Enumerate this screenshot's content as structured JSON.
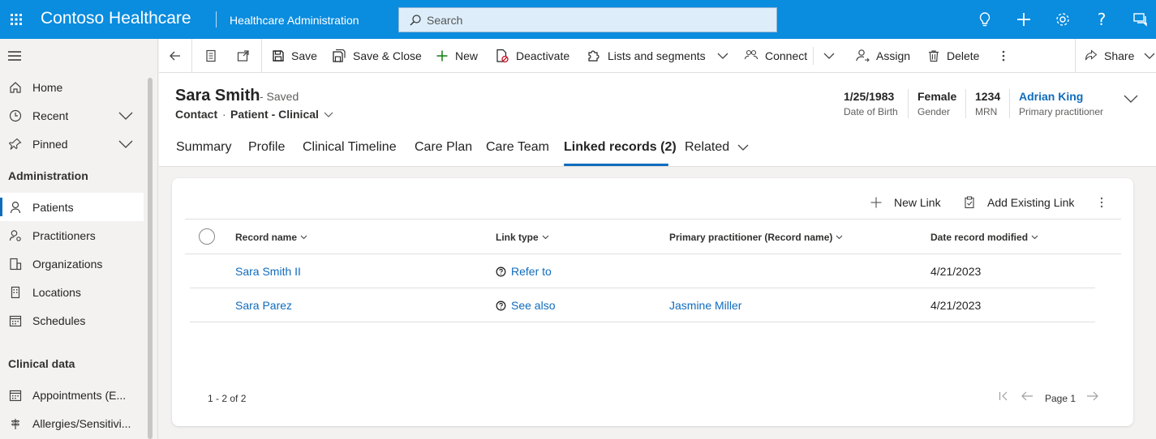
{
  "topbar": {
    "app_title": "Contoso Healthcare",
    "area_title": "Healthcare Administration",
    "search_placeholder": "Search",
    "icons": [
      "app-launcher-icon",
      "lightbulb-icon",
      "plus-icon",
      "settings-icon",
      "help-icon",
      "chat-icon"
    ]
  },
  "sidebar": {
    "items": [
      {
        "label": "Home",
        "icon": "home-icon"
      },
      {
        "label": "Recent",
        "icon": "clock-icon"
      },
      {
        "label": "Pinned",
        "icon": "pin-icon"
      }
    ],
    "group_admin": "Administration",
    "admin_items": [
      {
        "label": "Patients",
        "icon": "person-icon",
        "selected": true
      },
      {
        "label": "Practitioners",
        "icon": "practitioner-icon"
      },
      {
        "label": "Organizations",
        "icon": "organization-icon"
      },
      {
        "label": "Locations",
        "icon": "building-icon"
      },
      {
        "label": "Schedules",
        "icon": "calendar-icon"
      }
    ],
    "group_clinical": "Clinical data",
    "clinical_items": [
      {
        "label": "Appointments (E...",
        "icon": "calendar-icon"
      },
      {
        "label": "Allergies/Sensitivi...",
        "icon": "allergy-icon"
      }
    ]
  },
  "commands": {
    "save": "Save",
    "save_close": "Save & Close",
    "new": "New",
    "deactivate": "Deactivate",
    "lists": "Lists and segments",
    "connect": "Connect",
    "assign": "Assign",
    "delete": "Delete",
    "share": "Share"
  },
  "record": {
    "name": "Sara Smith",
    "saved": "- Saved",
    "entity": "Contact",
    "dot": "·",
    "form": "Patient - Clinical",
    "fields": [
      {
        "value": "1/25/1983",
        "label": "Date of Birth"
      },
      {
        "value": "Female",
        "label": "Gender"
      },
      {
        "value": "1234",
        "label": "MRN"
      },
      {
        "value": "Adrian King",
        "label": "Primary practitioner"
      }
    ]
  },
  "tabs": [
    {
      "label": "Summary"
    },
    {
      "label": "Profile"
    },
    {
      "label": "Clinical Timeline"
    },
    {
      "label": "Care Plan"
    },
    {
      "label": "Care Team"
    },
    {
      "label": "Linked records (2)",
      "active": true
    },
    {
      "label": "Related"
    }
  ],
  "grid": {
    "new_link": "New Link",
    "add_existing": "Add Existing Link",
    "columns": [
      "Record name",
      "Link type",
      "Primary practitioner (Record name)",
      "Date record modified"
    ],
    "rows": [
      {
        "record_name": "Sara Smith II",
        "link_type": "Refer to",
        "practitioner": "",
        "date": "4/21/2023"
      },
      {
        "record_name": "Sara Parez",
        "link_type": "See also",
        "practitioner": "Jasmine Miller",
        "date": "4/21/2023"
      }
    ],
    "count": "1 - 2 of 2",
    "page": "Page 1"
  },
  "colors": {
    "topbar": "#0a8cdf",
    "accent": "#0f6cbd",
    "link": "#0f6cbd"
  }
}
